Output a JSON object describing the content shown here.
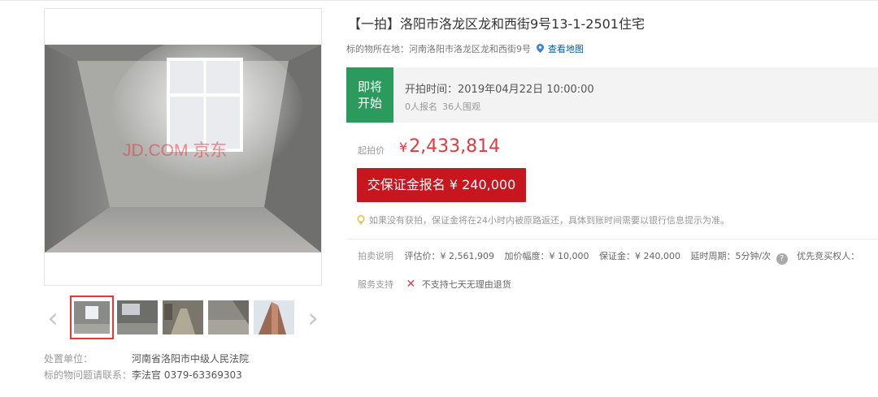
{
  "listing": {
    "title": "【一拍】洛阳市洛龙区龙和西街9号13-1-2501住宅",
    "location_label": "标的物所在地：",
    "location_value": "河南洛阳市洛龙区龙和西街9号",
    "map_link": "查看地图"
  },
  "gallery": {
    "watermark": "JD.COM 京东",
    "prev_arrow": "‹",
    "next_arrow": "›",
    "thumbnail_count": 5,
    "active_index": 0
  },
  "organizer": {
    "unit_label": "处置单位：",
    "unit_value": "河南省洛阳市中级人民法院",
    "contact_label": "标的物问题请联系：",
    "contact_value": "李法官 0379-63369303"
  },
  "status": {
    "badge_line1": "即将",
    "badge_line2": "开始",
    "start_time": "开拍时间：2019年04月22日 10:00:00",
    "signups": "0人报名",
    "views": "36人围观"
  },
  "price": {
    "label": "起拍价",
    "currency": "¥",
    "value": "2,433,814"
  },
  "deposit_button": "交保证金报名 ¥ 240,000",
  "notice": "如果没有获拍，保证金将在24小时内被原路返还，具体到账时间需要以银行信息提示为准。",
  "auction_info": {
    "label": "拍卖说明",
    "appraisal": "评估价：¥ 2,561,909",
    "increment": "加价幅度：¥ 10,000",
    "deposit": "保证金：¥ 240,000",
    "extension": "延时周期：5分钟/次",
    "priority": "优先竞买权人："
  },
  "service": {
    "label": "服务支持",
    "no_return": "不支持七天无理由退货"
  },
  "colors": {
    "accent_red": "#e4393c",
    "button_red": "#c7161e",
    "status_green": "#2b9a5d",
    "link_blue": "#005ea7"
  }
}
